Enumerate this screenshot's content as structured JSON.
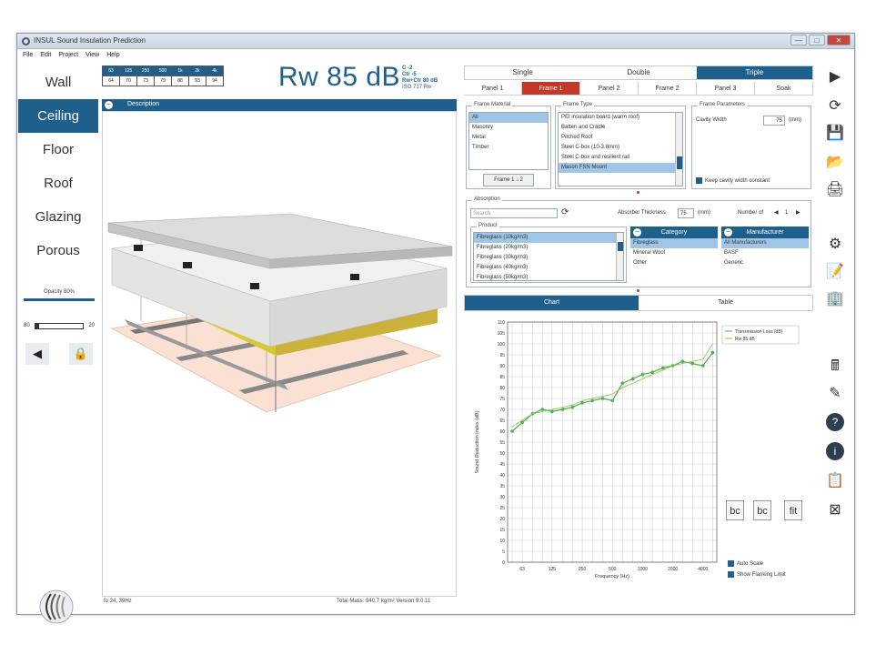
{
  "window": {
    "title": "INSUL Sound Insulation Prediction",
    "min": "—",
    "max": "□",
    "close": "✕"
  },
  "menu": [
    "File",
    "Edit",
    "Project",
    "View",
    "Help"
  ],
  "nav": [
    "Wall",
    "Ceiling",
    "Floor",
    "Roof",
    "Glazing",
    "Porous"
  ],
  "nav_active": 1,
  "opacity_label": "Opacity 80%",
  "volume": {
    "min": "80",
    "max": "20"
  },
  "freq_table": {
    "headers": [
      "63",
      "125",
      "250",
      "500",
      "1k",
      "2k",
      "4k"
    ],
    "values": [
      "64",
      "70",
      "73",
      "79",
      "88",
      "93",
      "94"
    ]
  },
  "rating": {
    "main": "Rw 85 dB",
    "c": "C -2",
    "ctr": "Ctr -5",
    "combined": "Rw+Ctr 80 dB",
    "sub": "ISO 717 Rw"
  },
  "view": {
    "header": "Description",
    "status_left": "fo 24, 39Hz",
    "status_right": "Total Mass: 940.7 kg/m²  Version 9.0.11"
  },
  "top_tabs": [
    "Single",
    "Double",
    "Triple"
  ],
  "top_active": 2,
  "panel_tabs": [
    "Panel 1",
    "Frame 1",
    "Panel 2",
    "Frame 2",
    "Panel 3",
    "Soak"
  ],
  "panel_active": 1,
  "frame_material": {
    "label": "Frame Material",
    "items": [
      "All",
      "Masonry",
      "Metal",
      "Timber"
    ],
    "selected": 0,
    "button": "Frame 1→2"
  },
  "frame_type": {
    "label": "Frame Type",
    "items": [
      "PEI insulation board (warm roof)",
      "Batten and Cradle",
      "Pitched Roof",
      "Steel C-box (10-3.8mm)",
      "Steel C-box and resilient rail",
      "Mason FSN Mount"
    ],
    "selected": 5
  },
  "frame_params": {
    "label": "Frame Parameters",
    "cavity_label": "Cavity Width",
    "cavity_value": "75",
    "unit": "(mm)",
    "keep_label": "Keep cavity width constant"
  },
  "absorption": {
    "label": "Absorption",
    "search_placeholder": "Search",
    "thickness_label": "Absorber Thickness",
    "thickness_value": "75",
    "unit": "(mm)",
    "number_label": "Number of",
    "number_value": "1",
    "product_label": "Product",
    "products": [
      "Fibreglass (10kg/m3)",
      "Fibreglass (20kg/m3)",
      "Fibreglass (30kg/m3)",
      "Fibreglass (40kg/m3)",
      "Fibreglass (50kg/m3)"
    ],
    "product_selected": 0,
    "category_head": "Category",
    "categories": [
      "Fibreglass",
      "Mineral Wool",
      "Other"
    ],
    "category_selected": 0,
    "manufacturer_head": "Manufacturer",
    "manufacturers": [
      "All Manufacturers",
      "BASF",
      "Generic"
    ],
    "manufacturer_selected": 0
  },
  "chart_tabs": [
    "Chart",
    "Table"
  ],
  "chart_active": 0,
  "checkboxes": {
    "auto_scale": "Auto Scale",
    "flanking": "Show Flanking Limit"
  },
  "chart_buttons": [
    "bc",
    "bc",
    "fit"
  ],
  "chart_data": {
    "type": "line",
    "x_ticks": [
      "63",
      "125",
      "250",
      "500",
      "1000",
      "2000",
      "4000"
    ],
    "xlabel": "Frequency (Hz)",
    "ylabel": "Sound Reduction Index (dB)",
    "ylim": [
      0,
      110
    ],
    "ytick_step": 5,
    "x": [
      50,
      63,
      80,
      100,
      125,
      160,
      200,
      250,
      315,
      400,
      500,
      630,
      800,
      1000,
      1250,
      1600,
      2000,
      2500,
      3150,
      4000,
      5000
    ],
    "series": [
      {
        "name": "Transmission Loss (dB)",
        "values": [
          60,
          64,
          68,
          70,
          69,
          70,
          71,
          73,
          74,
          75,
          74,
          82,
          84,
          86,
          87,
          89,
          90,
          92,
          91,
          90,
          96
        ]
      },
      {
        "name": "Rw 85 dB",
        "values": [
          62,
          65,
          68,
          69,
          70,
          71,
          72,
          74,
          75,
          76,
          77,
          80,
          82,
          84,
          86,
          88,
          90,
          91,
          92,
          93,
          100
        ]
      }
    ],
    "legend": "top-right",
    "grid": true,
    "colors": [
      "#4caf50",
      "#8bc34a"
    ]
  },
  "toolbar_icons": [
    "play-icon",
    "refresh-icon",
    "save-icon",
    "open-folder-icon",
    "print-icon",
    "settings-icon",
    "notes-icon",
    "building-icon",
    "calculator-icon",
    "edit-icon",
    "help-icon",
    "info-icon",
    "clipboard-icon",
    "export-icon"
  ],
  "toolbar_glyphs": [
    "▶",
    "⟳",
    "💾",
    "📂",
    "🖨",
    "⚙",
    "📝",
    "🏢",
    "🖩",
    "✎",
    "?",
    "i",
    "📋",
    "⊠"
  ]
}
